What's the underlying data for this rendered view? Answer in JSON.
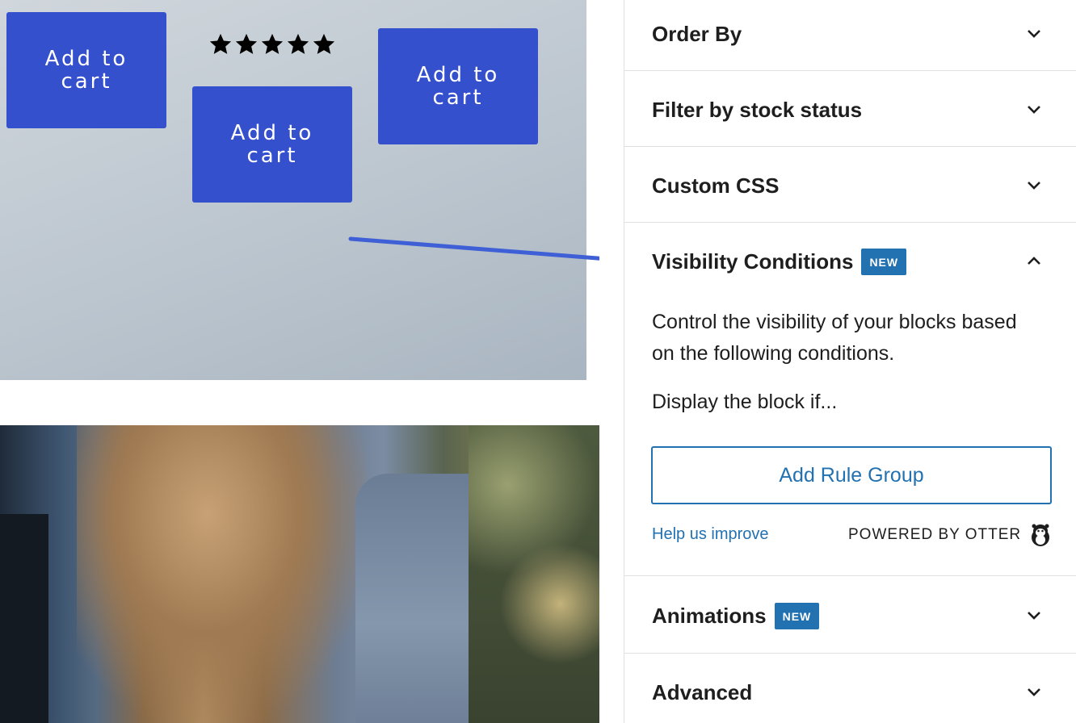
{
  "canvas": {
    "add_to_cart_buttons": [
      "Add to cart",
      "Add to cart",
      "Add to cart"
    ],
    "rating": {
      "stars": 5,
      "max": 5
    },
    "colors": {
      "button": "#3550cd",
      "arrow": "#3e5fd6"
    }
  },
  "sidebar": {
    "panels": {
      "order_by": {
        "title": "Order By",
        "state": "collapsed"
      },
      "stock_status": {
        "title": "Filter by stock status",
        "state": "collapsed"
      },
      "custom_css": {
        "title": "Custom CSS",
        "state": "collapsed"
      },
      "visibility": {
        "title": "Visibility Conditions",
        "badge": "NEW",
        "state": "expanded",
        "description": "Control the visibility of your blocks based on the following conditions.",
        "display_label": "Display the block if...",
        "add_rule_label": "Add Rule Group",
        "help_label": "Help us improve",
        "powered_by": "POWERED BY OTTER",
        "logo_icon": "otter-icon"
      },
      "animations": {
        "title": "Animations",
        "badge": "NEW",
        "state": "collapsed"
      },
      "advanced": {
        "title": "Advanced",
        "state": "collapsed"
      }
    },
    "colors": {
      "accent": "#2271b1",
      "text": "#1e1e1e",
      "border": "#e0e0e0"
    }
  }
}
